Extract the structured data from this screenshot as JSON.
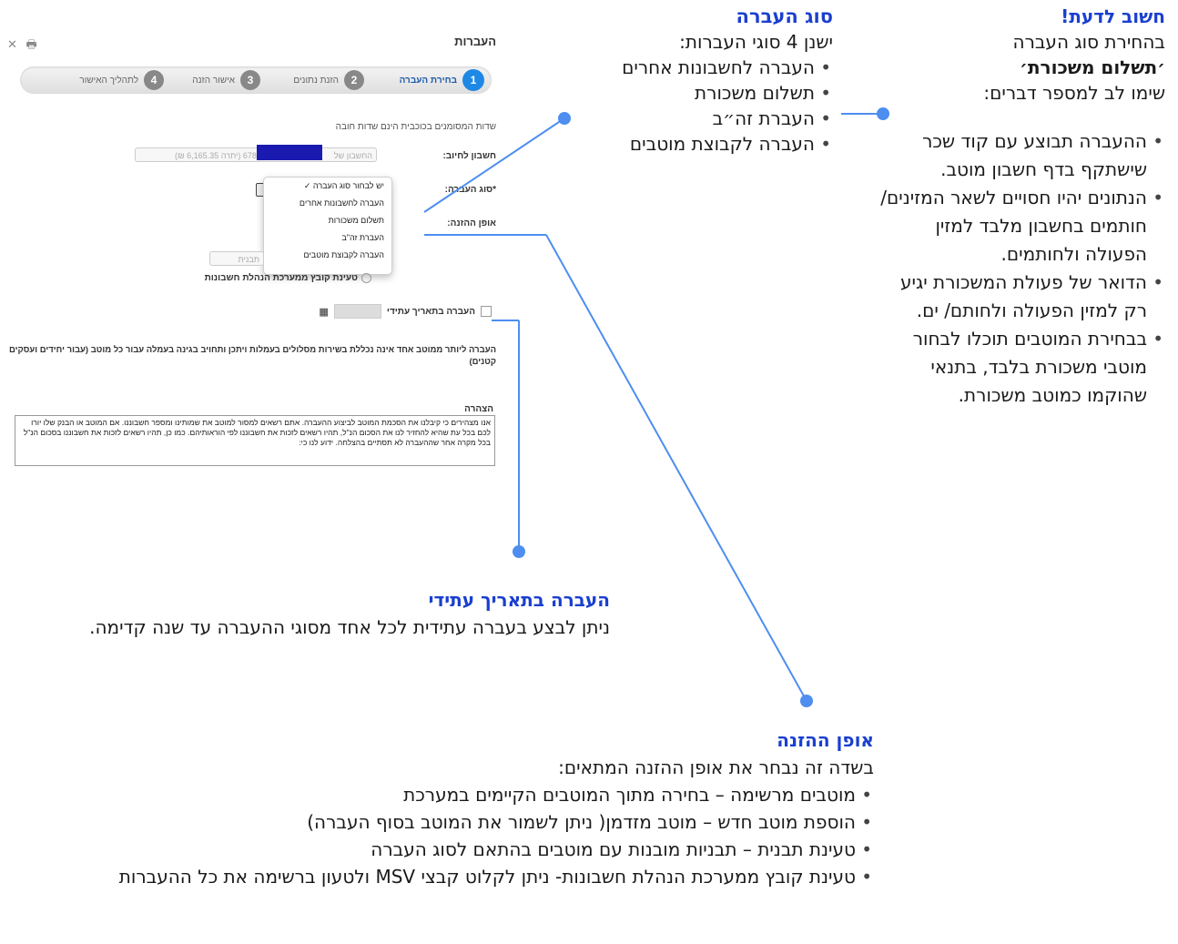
{
  "screen": {
    "page_title": "העברות",
    "icons": [
      "close-icon",
      "print-icon"
    ],
    "steps": [
      {
        "num": "1",
        "label": "בחירת העברה"
      },
      {
        "num": "2",
        "label": "הזנת נתונים"
      },
      {
        "num": "3",
        "label": "אישור הזנה"
      },
      {
        "num": "4",
        "label": "לתהליך האישור"
      }
    ],
    "required_note": "שדות המסומנים בכוכבית הינם שדות חובה",
    "debit_label": "חשבון לחיוב:",
    "debit_value": "החשבון של",
    "debit_balance": "678 (יתרה 6,165.35 ₪)",
    "transfer_type_label": "*סוג העברה:",
    "transfer_options": [
      "יש לבחור סוג העברה",
      "העברה לחשבונות אחרים",
      "תשלום משכורות",
      "העברת זה\"ב",
      "העברה לקבוצת מוטבים"
    ],
    "entry_label": "אופן ההזנה:",
    "template_placeholder": "תבנית",
    "load_file_label": "טעינת קובץ ממערכת הנהלת חשבונות",
    "future_label": "העברה בתאריך עתידי",
    "notice": "העברה ליותר ממוטב אחד אינה נכללת בשירות מסלולים בעמלות ויתכן ותחויב בגינה בעמלה עבור כל מוטב (עבור יחידים ועסקים קטנים)",
    "declaration_title": "הצהרה",
    "declaration_text": "אנו מצהירים כי קיבלנו את הסכמת המוטב לביצוע ההעברה. אתם רשאים למסור למוטב את שמותינו ומספר חשבוננו. אם המוטב או הבנק שלו יורו לכם בכל עת שהיא להחזיר לנו את הסכום הנ\"ל, תהיו רשאים לזכות את חשבוננו לפי הוראותיהם. כמו כן, תהיו רשאים לזכות את חשבוננו בסכום הנ\"ל בכל מקרה אחר שההעברה לא תסתיים בהצלחה. ידוע לנו כי:"
  },
  "annotations": {
    "transfer_type": {
      "title": "סוג העברה",
      "intro": "ישנן 4 סוגי העברות:",
      "items": [
        "העברה לחשבונות אחרים",
        "תשלום משכורת",
        "העברת זה״ב",
        "העברה לקבוצת מוטבים"
      ]
    },
    "important": {
      "title": "חשוב לדעת!",
      "line1": "בהחירת סוג העברה",
      "line2": "׳תשלום משכורת׳",
      "line3": "שימו לב למספר דברים:",
      "items": [
        "ההעברה תבוצע עם קוד שכר שישתקף בדף חשבון מוטב.",
        "הנתונים יהיו חסויים לשאר המזינים/ חותמים בחשבון מלבד למזין הפעולה ולחותמים.",
        "הדואר של פעולת המשכורת יגיע רק למזין הפעולה ולחותם/ ים.",
        "בבחירת המוטבים תוכלו לבחור מוטבי משכורת בלבד, בתנאי שהוקמו כמוטב משכורת."
      ]
    },
    "future": {
      "title": "העברה בתאריך עתידי",
      "text": "ניתן לבצע בעברה עתידית לכל אחד מסוגי ההעברה עד שנה קדימה."
    },
    "entry_method": {
      "title": "אופן ההזנה",
      "intro": "בשדה זה נבחר את אופן ההזנה המתאים:",
      "items": [
        "מוטבים מרשימה – בחירה מתוך המוטבים הקיימים במערכת",
        "הוספת מוטב חדש – מוטב מזדמן( ניתן לשמור את המוטב בסוף העברה)",
        "טעינת תבנית – תבניות מובנות עם מוטבים בהתאם לסוג העברה",
        "טעינת קובץ ממערכת הנהלת חשבונות- ניתן לקלוט קבצי MSV  ולטעון ברשימה את כל ההעברות"
      ]
    }
  },
  "colors": {
    "accent": "#1a3fcf",
    "line": "#4d8ef0",
    "step_active": "#1e88e5",
    "step_inactive": "#888888",
    "redaction": "#1a1ab0"
  }
}
